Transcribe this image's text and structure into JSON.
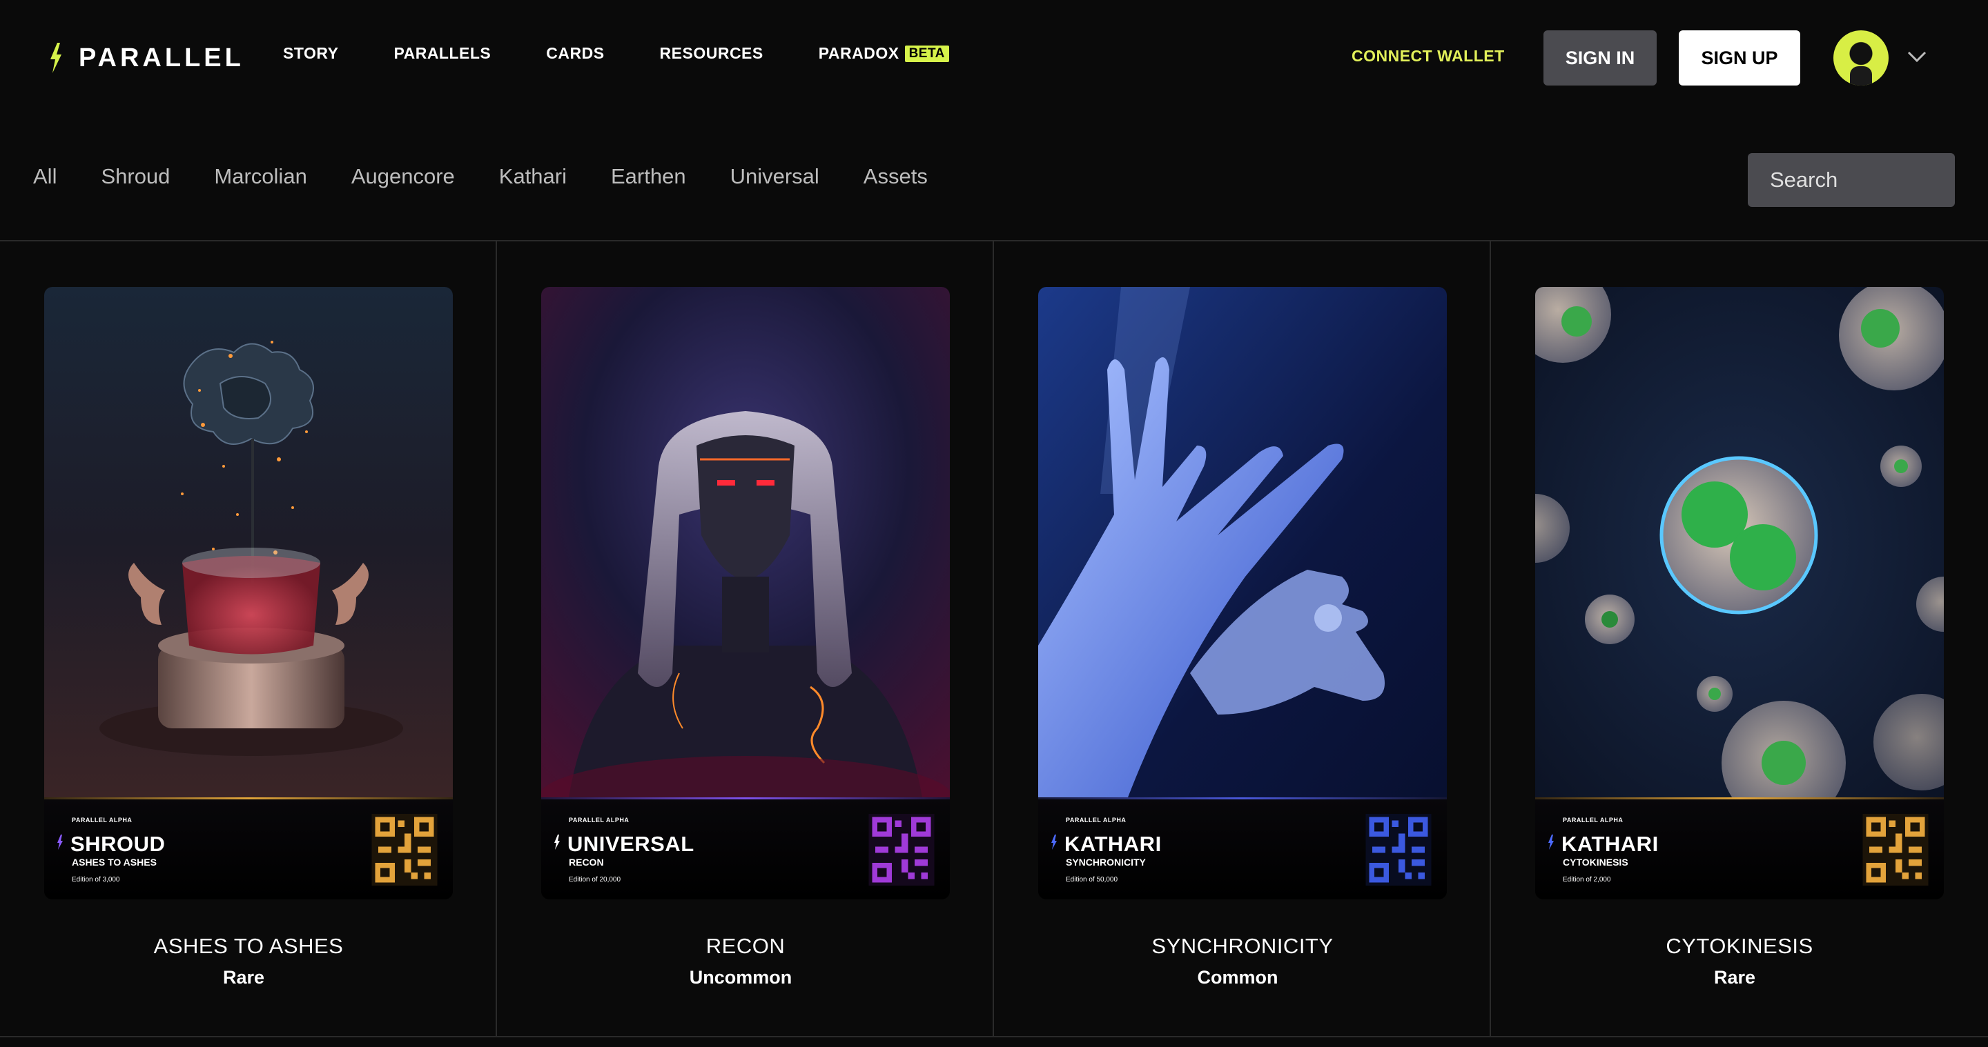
{
  "brand": {
    "name": "PARALLEL",
    "accent": "#d6f34a"
  },
  "nav": {
    "items": [
      "STORY",
      "PARALLELS",
      "CARDS",
      "RESOURCES"
    ],
    "paradox_label": "PARADOX",
    "paradox_badge": "BETA"
  },
  "header": {
    "connect_wallet": "CONNECT WALLET",
    "sign_in": "SIGN IN",
    "sign_up": "SIGN UP"
  },
  "filters": [
    "All",
    "Shroud",
    "Marcolian",
    "Augencore",
    "Kathari",
    "Earthen",
    "Universal",
    "Assets"
  ],
  "search": {
    "placeholder": "Search"
  },
  "cards": [
    {
      "series": "PARALLEL ALPHA",
      "parallel": "SHROUD",
      "card_name": "ASHES TO ASHES",
      "edition": "Edition of 3,000",
      "title": "ASHES TO ASHES",
      "rarity": "Rare",
      "accent": "#e0a43a",
      "qr_color": "#e3a33b",
      "bolt_color": "#8a5bff"
    },
    {
      "series": "PARALLEL ALPHA",
      "parallel": "UNIVERSAL",
      "card_name": "RECON",
      "edition": "Edition of 20,000",
      "title": "RECON",
      "rarity": "Uncommon",
      "accent": "#7d52e8",
      "qr_color": "#a03ad8",
      "bolt_color": "#ffffff"
    },
    {
      "series": "PARALLEL ALPHA",
      "parallel": "KATHARI",
      "card_name": "SYNCHRONICITY",
      "edition": "Edition of 50,000",
      "title": "SYNCHRONICITY",
      "rarity": "Common",
      "accent": "#4a58d8",
      "qr_color": "#3b59e0",
      "bolt_color": "#4d6bff"
    },
    {
      "series": "PARALLEL ALPHA",
      "parallel": "KATHARI",
      "card_name": "CYTOKINESIS",
      "edition": "Edition of 2,000",
      "title": "CYTOKINESIS",
      "rarity": "Rare",
      "accent": "#e0a43a",
      "qr_color": "#e3a33b",
      "bolt_color": "#4d6bff"
    }
  ]
}
